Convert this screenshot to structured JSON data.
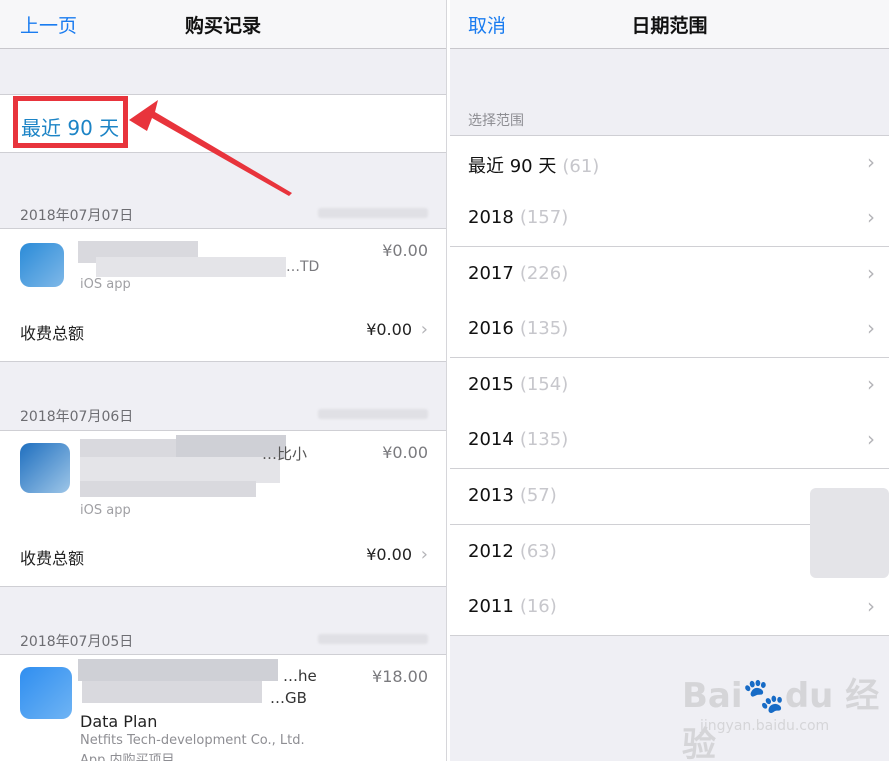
{
  "left": {
    "nav": {
      "back": "上一页",
      "title": "购买记录"
    },
    "filter": {
      "label": "最近 90 天"
    },
    "sections": [
      {
        "date": "2018年07月07日",
        "item": {
          "name_partial": "…TD",
          "price": "¥0.00",
          "platform": "iOS app"
        },
        "total": {
          "label": "收费总额",
          "value": "¥0.00"
        }
      },
      {
        "date": "2018年07月06日",
        "item": {
          "name_partial": "…比小",
          "price": "¥0.00",
          "platform": "iOS app"
        },
        "total": {
          "label": "收费总额",
          "value": "¥0.00"
        }
      },
      {
        "date": "2018年07月05日",
        "item": {
          "name_partial_1": "…he",
          "name_partial_2": "…GB",
          "name_line": "Data Plan",
          "price": "¥18.00",
          "developer": "Netfits Tech-development Co., Ltd.",
          "type": "App 内购买项目"
        }
      }
    ]
  },
  "right": {
    "nav": {
      "cancel": "取消",
      "title": "日期范围"
    },
    "section_header": "选择范围",
    "ranges": [
      {
        "label": "最近 90 天",
        "count": "(61)",
        "chevron": true
      },
      {
        "label": "2018",
        "count": "(157)",
        "chevron": true
      },
      {
        "label": "2017",
        "count": "(226)",
        "chevron": true
      },
      {
        "label": "2016",
        "count": "(135)",
        "chevron": true
      },
      {
        "label": "2015",
        "count": "(154)",
        "chevron": true
      },
      {
        "label": "2014",
        "count": "(135)",
        "chevron": true
      },
      {
        "label": "2013",
        "count": "(57)",
        "chevron": false
      },
      {
        "label": "2012",
        "count": "(63)",
        "chevron": false
      },
      {
        "label": "2011",
        "count": "(16)",
        "chevron": true
      }
    ]
  },
  "watermark": {
    "logo": "Bai🐾du 经验",
    "url": "jingyan.baidu.com"
  },
  "colors": {
    "accent_blue": "#1a7cf0",
    "highlight_red": "#e8343c",
    "background": "#efeff4"
  },
  "icons": {
    "chevron": "chevron-right-icon",
    "annotation": "red-arrow-icon"
  }
}
